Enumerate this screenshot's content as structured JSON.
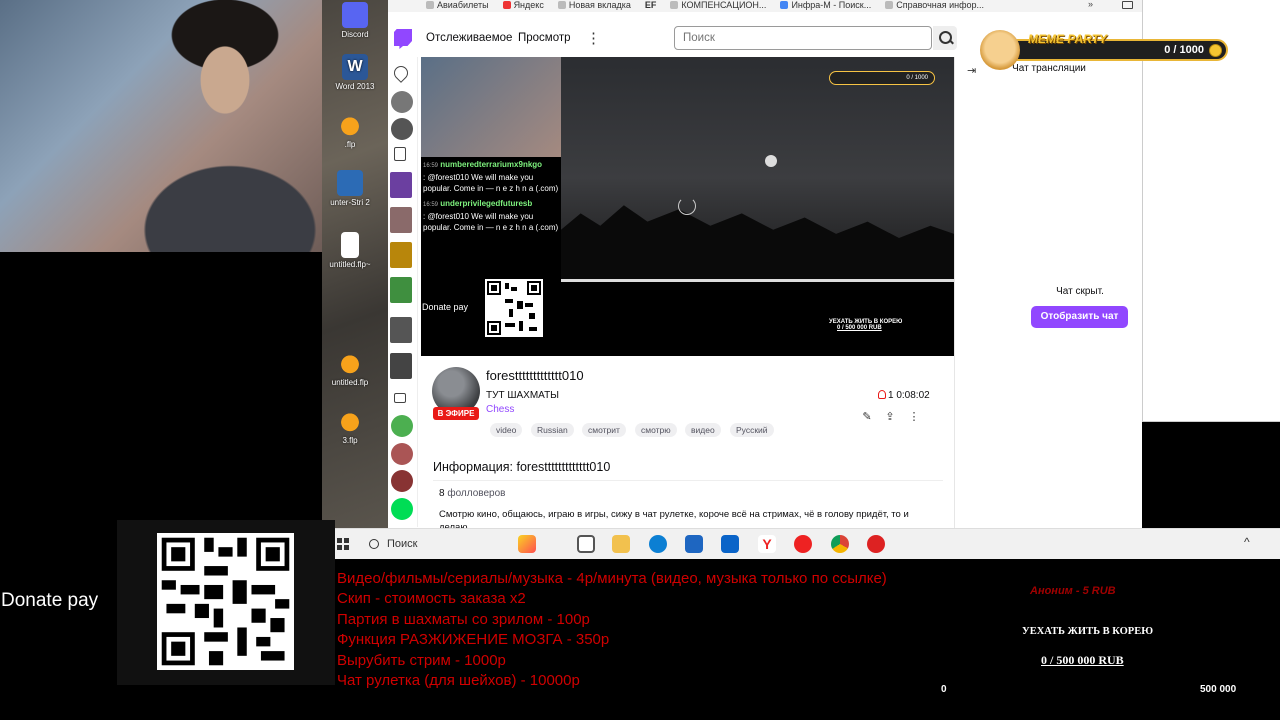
{
  "bookmarks": [
    "Авиабилеты",
    "Яндекс",
    "Новая вкладка",
    "EF",
    "КОМПЕНСАЦИОН...",
    "Инфра-М - Поиск...",
    "Справочная инфор..."
  ],
  "bookmarks_more": "»",
  "desktop_icons": [
    "Discord",
    "Word 2013",
    ".flp",
    "unter-Stri 2",
    "untitled.flp~",
    "untitled.flp",
    "3.flp"
  ],
  "twitch": {
    "nav_following": "Отслеживаемое",
    "nav_browse": "Просмотр",
    "more": "⋮",
    "search_placeholder": "Поиск"
  },
  "stream_overlay_mini": {
    "chat": [
      {
        "name": "numberedterrariumx9nkgo",
        "text": ": @forest010 We will make you popular. Come in — n e z h n a (.com)"
      },
      {
        "name": "underprivilegedfuturesb",
        "text": ": @forest010 We will make you popular. Come in — n e z h n a (.com)"
      }
    ],
    "time_1": "16:59",
    "time_2": "16:59",
    "donate_label": "Donate pay",
    "goal_title": "УЕХАТЬ ЖИТЬ В КОРЕЮ",
    "goal_amount": "0 / 500 000 RUB",
    "badge": "0 / 1000"
  },
  "channel": {
    "name": "foresttttttttttttt010",
    "live": "В ЭФИРЕ",
    "title": "ТУТ ШАХМАТЫ",
    "game": "Chess",
    "tags": [
      "video",
      "Russian",
      "смотрит",
      "смотрю",
      "видео",
      "Русский"
    ],
    "viewers": "1",
    "uptime": "0:08:02"
  },
  "about": {
    "title": "Информация: foresttttttttttttt010",
    "followers_count": "8",
    "followers_label": "фолловеров",
    "bio": "Смотрю кино, общаюсь, играю в игры, сижу в чат рулетке, короче всё на стримах, чё в голову придёт, то и делаю"
  },
  "chat": {
    "header": "Чат трансляции",
    "collapse": "⇥",
    "hidden_text": "Чат скрыт.",
    "show_button": "Отобразить чат"
  },
  "meme_party": {
    "title": "MEME PARTY",
    "count": "0 / 1000"
  },
  "taskbar": {
    "search": "Поиск",
    "chevron": "^"
  },
  "overlay": {
    "rules": [
      "Видео/фильмы/сериалы/музыка - 4р/минута (видео, музыка только по ссылке)",
      "Скип - стоимость заказа х2",
      "Партия в шахматы со зрилом - 100р",
      "Функция РАЗЖИЖЕНИЕ МОЗГА - 350р",
      "Вырубить стрим - 1000р",
      "Чат рулетка (для шейхов) - 10000р"
    ],
    "alert": "Аноним - 5 RUB",
    "goal_title": "УЕХАТЬ ЖИТЬ В КОРЕЮ",
    "goal_amount": "0 / 500 000 RUB",
    "goal_min": "0",
    "goal_max": "500 000"
  },
  "donate": {
    "label": "Donate pay"
  }
}
